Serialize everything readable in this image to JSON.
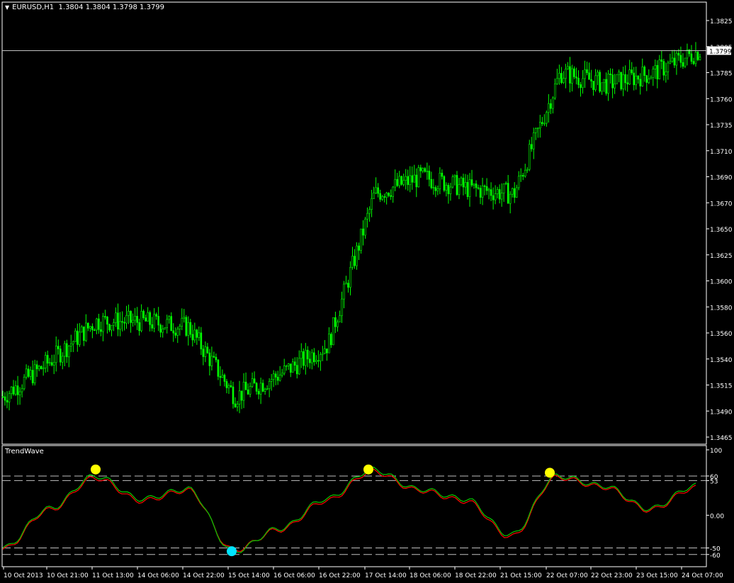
{
  "header": {
    "symbol_tf": "EURUSD,H1",
    "ohlc": "1.3804 1.3804 1.3798 1.3799"
  },
  "indicator": {
    "name": "TrendWave"
  },
  "price_axis": {
    "ticks": [
      "1.3825",
      "1.3805",
      "1.3785",
      "1.3760",
      "1.3735",
      "1.3710",
      "1.3690",
      "1.3670",
      "1.3650",
      "1.3625",
      "1.3600",
      "1.3580",
      "1.3560",
      "1.3540",
      "1.3515",
      "1.3490",
      "1.3465"
    ],
    "current_price": "1.3799"
  },
  "indicator_axis": {
    "ticks": [
      "100",
      "60",
      "53",
      "0.00",
      "-50",
      "-60"
    ]
  },
  "time_axis": {
    "labels": [
      "10 Oct 2013",
      "10 Oct 21:00",
      "11 Oct 13:00",
      "14 Oct 06:00",
      "14 Oct 22:00",
      "15 Oct 14:00",
      "16 Oct 06:00",
      "16 Oct 22:00",
      "17 Oct 14:00",
      "18 Oct 06:00",
      "18 Oct 22:00",
      "21 Oct 15:00",
      "22 Oct 07:00",
      "22 Oct 23:00",
      "23 Oct 15:00",
      "24 Oct 07:00"
    ]
  },
  "colors": {
    "background": "#000000",
    "frame": "#ffffff",
    "candle": "#00ff00",
    "osc_fast": "#00cc00",
    "osc_slow": "#ff0000",
    "level_lines": "#c0c0c0",
    "signal_top": "#ffff00",
    "signal_bottom": "#00e5ff"
  },
  "chart_data": [
    {
      "type": "line",
      "title": "EURUSD,H1",
      "ylim": [
        1.3465,
        1.3825
      ],
      "x": [
        "10 Oct 2013",
        "10 Oct 21:00",
        "11 Oct 13:00",
        "14 Oct 06:00",
        "14 Oct 22:00",
        "15 Oct 14:00",
        "16 Oct 06:00",
        "16 Oct 22:00",
        "17 Oct 14:00",
        "18 Oct 06:00",
        "18 Oct 22:00",
        "21 Oct 15:00",
        "22 Oct 07:00",
        "22 Oct 23:00",
        "23 Oct 15:00",
        "24 Oct 07:00"
      ],
      "series": [
        {
          "values": [
            1.35,
            1.353,
            1.3565,
            1.3565,
            1.356,
            1.35,
            1.352,
            1.3545,
            1.3675,
            1.369,
            1.368,
            1.3675,
            1.378,
            1.377,
            1.378,
            1.3799
          ]
        }
      ]
    },
    {
      "type": "line",
      "title": "TrendWave",
      "ylim": [
        -70,
        100
      ],
      "reference_lines": [
        60,
        53,
        -50,
        -60
      ],
      "x": [
        "10 Oct 2013",
        "10 Oct 21:00",
        "11 Oct 13:00",
        "14 Oct 06:00",
        "14 Oct 22:00",
        "15 Oct 14:00",
        "16 Oct 06:00",
        "16 Oct 22:00",
        "17 Oct 14:00",
        "18 Oct 06:00",
        "18 Oct 22:00",
        "21 Oct 15:00",
        "22 Oct 07:00",
        "22 Oct 23:00",
        "23 Oct 15:00",
        "24 Oct 07:00"
      ],
      "series": [
        {
          "values": [
            -50,
            10,
            60,
            25,
            40,
            -55,
            -20,
            25,
            70,
            40,
            25,
            -30,
            60,
            45,
            10,
            45
          ]
        },
        {
          "values": [
            -52,
            8,
            57,
            22,
            38,
            -53,
            -22,
            22,
            67,
            38,
            22,
            -33,
            58,
            43,
            8,
            42
          ]
        }
      ],
      "signals": [
        {
          "x": "11 Oct 13:00",
          "y": 70,
          "kind": "top"
        },
        {
          "x": "15 Oct 14:00",
          "y": -55,
          "kind": "bottom"
        },
        {
          "x": "17 Oct 14:00",
          "y": 70,
          "kind": "top"
        },
        {
          "x": "22 Oct 07:00",
          "y": 65,
          "kind": "top"
        }
      ]
    }
  ]
}
